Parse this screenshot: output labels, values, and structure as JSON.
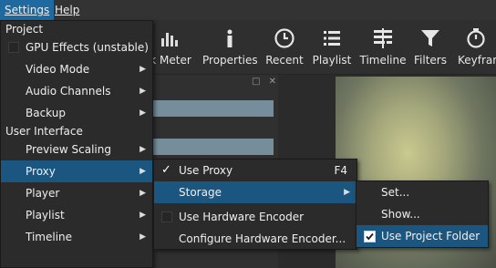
{
  "menubar": {
    "items": [
      "Settings",
      "Help"
    ]
  },
  "toolbar": {
    "buttons": [
      {
        "label": "sk Meter",
        "icon": "peak-meter-icon"
      },
      {
        "label": "Properties",
        "icon": "info-icon"
      },
      {
        "label": "Recent",
        "icon": "clock-icon"
      },
      {
        "label": "Playlist",
        "icon": "list-icon"
      },
      {
        "label": "Timeline",
        "icon": "timeline-icon"
      },
      {
        "label": "Filters",
        "icon": "filter-icon"
      },
      {
        "label": "Keyfram",
        "icon": "stopwatch-icon"
      }
    ]
  },
  "settings_menu": {
    "section_project": "Project",
    "gpu_effects": "GPU Effects (unstable)",
    "video_mode": "Video Mode",
    "audio_channels": "Audio Channels",
    "backup": "Backup",
    "section_ui": "User Interface",
    "preview_scaling": "Preview Scaling",
    "proxy": "Proxy",
    "player": "Player",
    "playlist": "Playlist",
    "timeline": "Timeline"
  },
  "proxy_menu": {
    "use_proxy": "Use Proxy",
    "use_proxy_shortcut": "F4",
    "storage": "Storage",
    "use_hw_encoder": "Use Hardware Encoder",
    "configure_hw_encoder": "Configure Hardware Encoder..."
  },
  "storage_menu": {
    "set": "Set...",
    "show": "Show...",
    "use_project_folder": "Use Project Folder"
  },
  "colors": {
    "highlight": "#1a5680",
    "menubar_active": "#1e6aa0"
  }
}
